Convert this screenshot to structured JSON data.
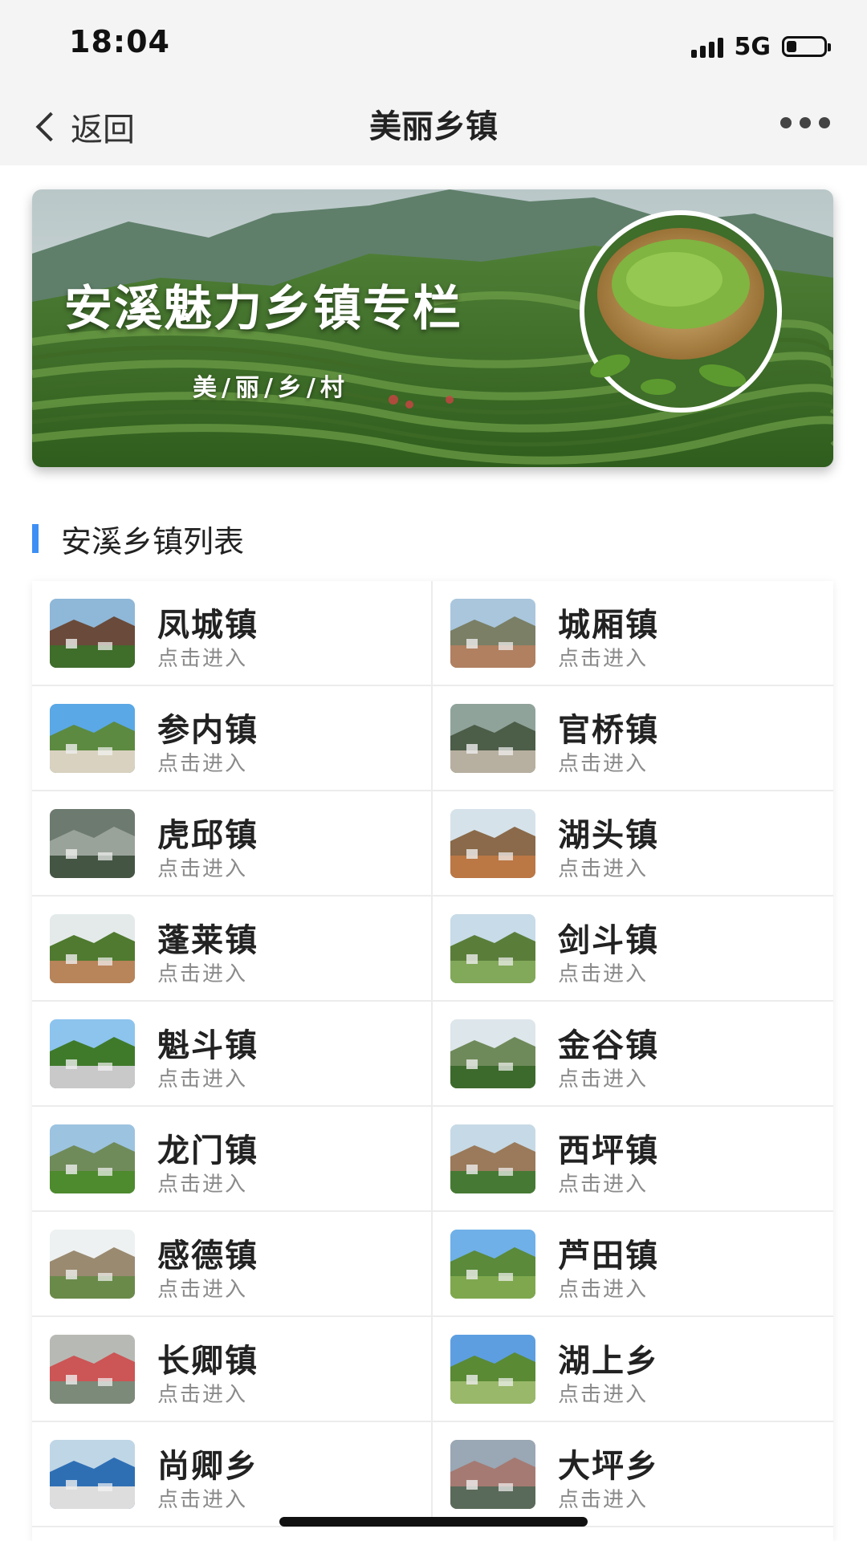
{
  "status_bar": {
    "time": "18:04",
    "network": "5G"
  },
  "nav": {
    "back_label": "返回",
    "title": "美丽乡镇"
  },
  "banner": {
    "title": "安溪魅力乡镇专栏",
    "subtitle": "美/丽/乡/村"
  },
  "section": {
    "title": "安溪乡镇列表"
  },
  "towns": [
    {
      "name": "凤城镇",
      "action": "点击进入"
    },
    {
      "name": "城厢镇",
      "action": "点击进入"
    },
    {
      "name": "参内镇",
      "action": "点击进入"
    },
    {
      "name": "官桥镇",
      "action": "点击进入"
    },
    {
      "name": "虎邱镇",
      "action": "点击进入"
    },
    {
      "name": "湖头镇",
      "action": "点击进入"
    },
    {
      "name": "蓬莱镇",
      "action": "点击进入"
    },
    {
      "name": "剑斗镇",
      "action": "点击进入"
    },
    {
      "name": "魁斗镇",
      "action": "点击进入"
    },
    {
      "name": "金谷镇",
      "action": "点击进入"
    },
    {
      "name": "龙门镇",
      "action": "点击进入"
    },
    {
      "name": "西坪镇",
      "action": "点击进入"
    },
    {
      "name": "感德镇",
      "action": "点击进入"
    },
    {
      "name": "芦田镇",
      "action": "点击进入"
    },
    {
      "name": "长卿镇",
      "action": "点击进入"
    },
    {
      "name": "湖上乡",
      "action": "点击进入"
    },
    {
      "name": "尚卿乡",
      "action": "点击进入"
    },
    {
      "name": "大坪乡",
      "action": "点击进入"
    }
  ],
  "colors": {
    "accent": "#3d8ff5",
    "subtext": "#8a8a8a",
    "nav_bg": "#f4f4f4"
  }
}
